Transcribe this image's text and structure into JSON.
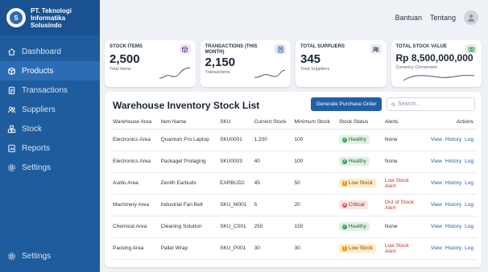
{
  "brand": {
    "name_line1": "PT. Teknologi",
    "name_line2": "Informatika Solusindo",
    "logo_letter": "S"
  },
  "sidebar": {
    "items": [
      {
        "label": "Dashboard",
        "icon": "home-icon"
      },
      {
        "label": "Products",
        "icon": "box-icon"
      },
      {
        "label": "Transactions",
        "icon": "document-icon"
      },
      {
        "label": "Suppliers",
        "icon": "users-icon"
      },
      {
        "label": "Stock",
        "icon": "warehouse-icon"
      },
      {
        "label": "Reports",
        "icon": "report-icon"
      },
      {
        "label": "Settings",
        "icon": "gear-icon"
      }
    ],
    "bottom": {
      "label": "Settings",
      "icon": "gear-icon"
    }
  },
  "topbar": {
    "help": "Bantuan",
    "about": "Tentang"
  },
  "cards": [
    {
      "title": "STOCK ITEMS",
      "value": "2,500",
      "sub": "Total Items",
      "icon": "box-icon",
      "icon_bg": "#ece3f7"
    },
    {
      "title": "TRANSACTIONS (THIS MONTH)",
      "value": "2,150",
      "sub": "Transactions",
      "icon": "document-icon",
      "icon_bg": "#e1e8f5"
    },
    {
      "title": "TOTAL SUPPLIERS",
      "value": "345",
      "sub": "Total Suppliers",
      "icon": "users-icon",
      "icon_bg": "#e8ecf1"
    },
    {
      "title": "TOTAL STOCK VALUE",
      "value": "Rp 8,500,000,000",
      "sub": "Currency Conversion",
      "icon": "money-icon",
      "icon_bg": "#dff2e3"
    }
  ],
  "table": {
    "title": "Warehouse Inventory Stock List",
    "generate_button": "Generate Purchase Order",
    "search_placeholder": "Search...",
    "headers": [
      "Warehouse Area",
      "Item Name",
      "SKU",
      "Current Stock",
      "Minimum Stock",
      "Stock Status",
      "Alerts",
      "Actions"
    ],
    "action_labels": [
      "View",
      "History",
      "Log"
    ],
    "rows": [
      {
        "area": "Electronics Area",
        "item": "Quantum Pro Laptop",
        "sku": "SKU0001",
        "current": "1,200",
        "minimum": "100",
        "status": "Healthy",
        "status_type": "healthy",
        "alert": "None",
        "alert_type": "none"
      },
      {
        "area": "Electronics Area",
        "item": "Packagel Prolaging",
        "sku": "SKU0003",
        "current": "40",
        "minimum": "100",
        "status": "Healthy",
        "status_type": "healthy",
        "alert": "None",
        "alert_type": "none"
      },
      {
        "area": "Audio Area",
        "item": "Zenith Earbuds",
        "sku": "EARBUD2",
        "current": "45",
        "minimum": "50",
        "status": "Low Stock",
        "status_type": "low",
        "alert": "Low Stock Alert",
        "alert_type": "red"
      },
      {
        "area": "Machinery Area",
        "item": "Industrial Fan Belt",
        "sku": "SKU_M001",
        "current": "5",
        "minimum": "20",
        "status": "Critical",
        "status_type": "critical",
        "alert": "Out of Stock Alert",
        "alert_type": "red"
      },
      {
        "area": "Chemical Area",
        "item": "Cleaning Solution",
        "sku": "SKU_C001",
        "current": "250",
        "minimum": "150",
        "status": "Healthy",
        "status_type": "healthy",
        "alert": "None",
        "alert_type": "none"
      },
      {
        "area": "Packing Area",
        "item": "Pallet Wrap",
        "sku": "SKU_P001",
        "current": "30",
        "minimum": "30",
        "status": "Low Stock",
        "status_type": "low",
        "alert": "Low Stock Alert",
        "alert_type": "red"
      }
    ]
  },
  "colors": {
    "sidebar": "#1f5c9e",
    "active": "#2b6cb5",
    "primary_button": "#2160a8",
    "alert_red": "#c0392b"
  }
}
